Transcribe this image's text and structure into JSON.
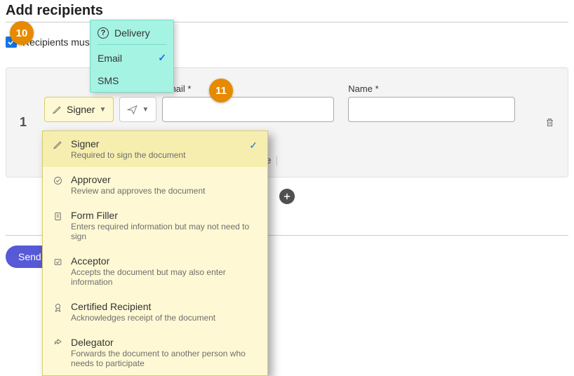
{
  "title": "Add recipients",
  "order_label": "Recipients must",
  "order_checked": true,
  "recipient": {
    "index": "1",
    "role_button": "Signer",
    "email_label": "Email *",
    "email_value": "",
    "name_label": "Name *",
    "name_value": "",
    "auth_method": "None"
  },
  "delivery_popup": {
    "header": "Delivery",
    "items": [
      {
        "label": "Email",
        "selected": true
      },
      {
        "label": "SMS",
        "selected": false
      }
    ]
  },
  "role_popup": [
    {
      "name": "Signer",
      "desc": "Required to sign the document",
      "selected": true,
      "icon": "pen"
    },
    {
      "name": "Approver",
      "desc": "Review and approves the document",
      "selected": false,
      "icon": "check-circle"
    },
    {
      "name": "Form Filler",
      "desc": "Enters required information but may not need to sign",
      "selected": false,
      "icon": "form"
    },
    {
      "name": "Acceptor",
      "desc": "Accepts the document but may also enter information",
      "selected": false,
      "icon": "accept"
    },
    {
      "name": "Certified Recipient",
      "desc": "Acknowledges receipt of the document",
      "selected": false,
      "icon": "ribbon"
    },
    {
      "name": "Delegator",
      "desc": "Forwards the document to another person who needs to participate",
      "selected": false,
      "icon": "forward"
    }
  ],
  "send_label": "Send",
  "badges": {
    "b10": "10",
    "b11": "11"
  }
}
